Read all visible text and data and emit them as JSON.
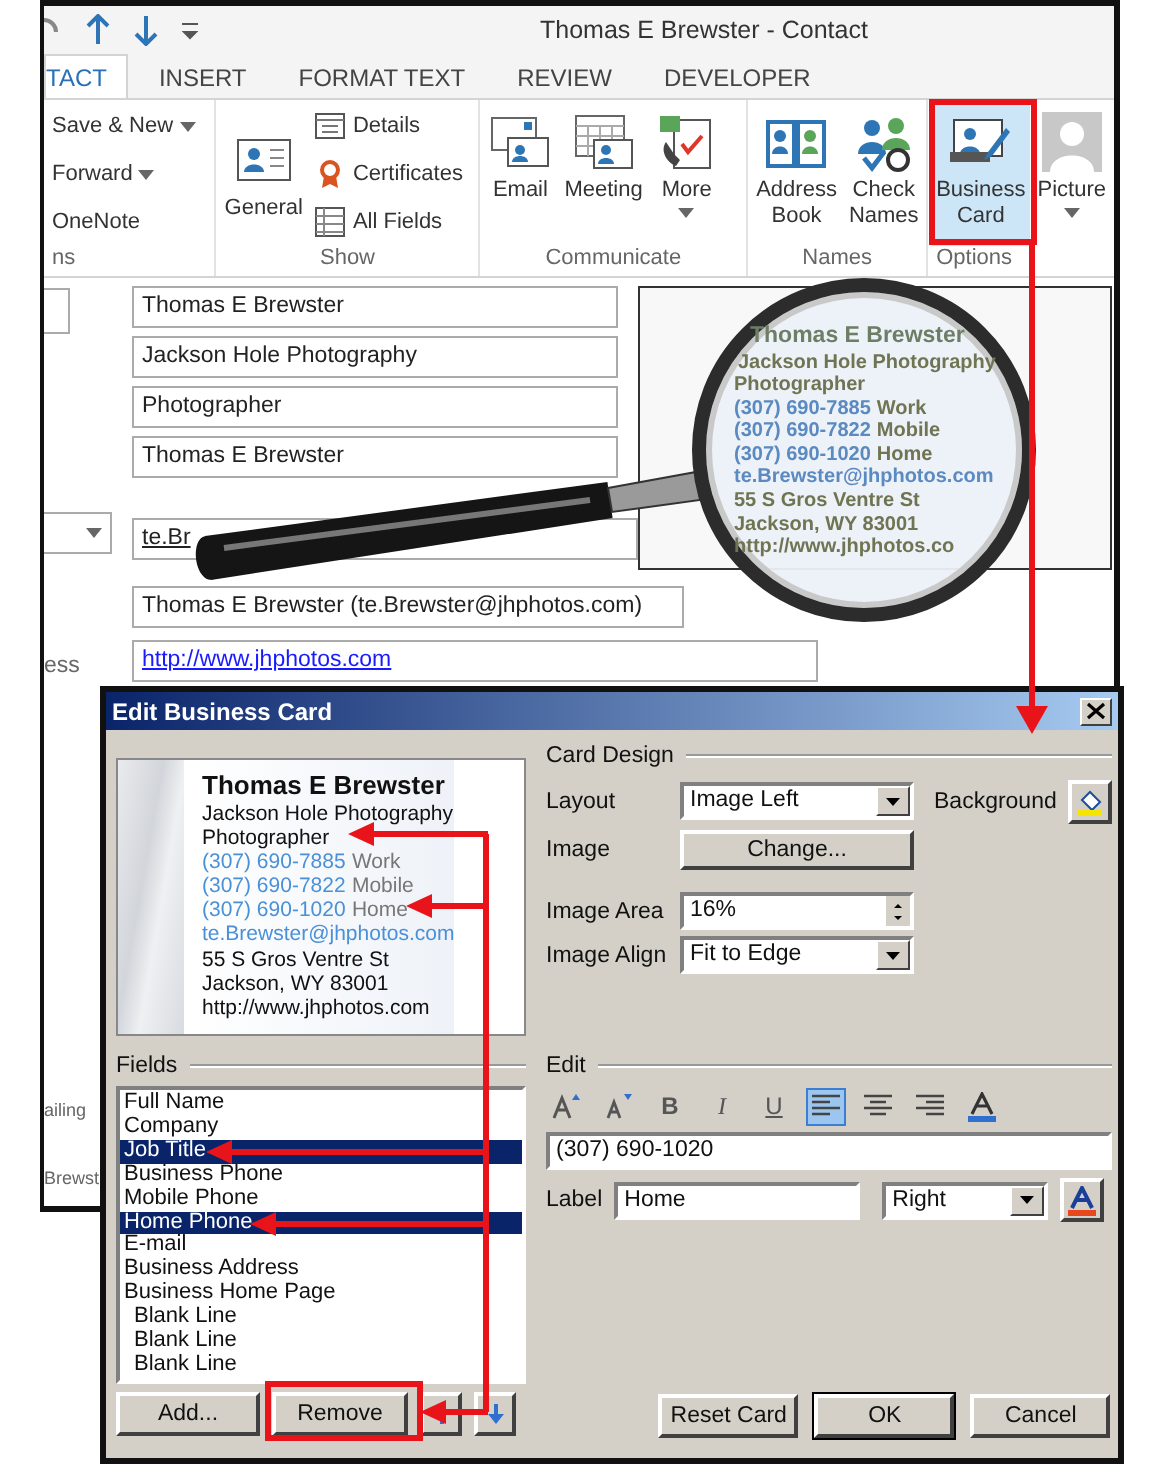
{
  "window": {
    "title": "Thomas E Brewster - Contact"
  },
  "tabs": [
    {
      "label": "TACT",
      "selected": true
    },
    {
      "label": "INSERT",
      "selected": false
    },
    {
      "label": "FORMAT TEXT",
      "selected": false
    },
    {
      "label": "REVIEW",
      "selected": false
    },
    {
      "label": "DEVELOPER",
      "selected": false
    }
  ],
  "ribbon": {
    "groups": [
      {
        "label": "ns",
        "buttons": [
          {
            "label": "Save & New",
            "kind": "small",
            "dropdown": true,
            "highlighted": false
          },
          {
            "label": "Forward",
            "kind": "small",
            "dropdown": true,
            "highlighted": false
          },
          {
            "label": "OneNote",
            "kind": "small",
            "dropdown": false,
            "highlighted": false
          }
        ]
      },
      {
        "label": "Show",
        "buttons": [
          {
            "label": "General",
            "kind": "large",
            "dropdown": false,
            "highlighted": false
          },
          {
            "label": "Details",
            "kind": "small",
            "dropdown": false,
            "highlighted": false
          },
          {
            "label": "Certificates",
            "kind": "small",
            "dropdown": false,
            "highlighted": false
          },
          {
            "label": "All Fields",
            "kind": "small",
            "dropdown": false,
            "highlighted": false
          }
        ]
      },
      {
        "label": "Communicate",
        "buttons": [
          {
            "label": "Email",
            "kind": "large",
            "dropdown": false,
            "highlighted": false
          },
          {
            "label": "Meeting",
            "kind": "large",
            "dropdown": false,
            "highlighted": false
          },
          {
            "label": "More",
            "kind": "large",
            "dropdown": true,
            "highlighted": false
          }
        ]
      },
      {
        "label": "Names",
        "buttons": [
          {
            "label": "Address Book",
            "kind": "large",
            "dropdown": false,
            "highlighted": false
          },
          {
            "label": "Check Names",
            "kind": "large",
            "dropdown": false,
            "highlighted": false
          }
        ]
      },
      {
        "label": "Options",
        "buttons": [
          {
            "label": "Business Card",
            "kind": "large",
            "dropdown": false,
            "highlighted": true
          },
          {
            "label": "Picture",
            "kind": "large",
            "dropdown": true,
            "highlighted": false
          }
        ]
      }
    ]
  },
  "form": {
    "fields": [
      "Thomas E Brewster",
      "Jackson Hole Photography",
      "Photographer",
      "Thomas E Brewster"
    ],
    "email": "te.Br",
    "display_as": "Thomas E Brewster (te.Brewster@jhphotos.com)",
    "web_label": "ess",
    "web_page": "http://www.jhphotos.com",
    "hidden_labels": [
      "ailing",
      "Brewst"
    ]
  },
  "magnifier": {
    "lines": [
      {
        "kind": "name",
        "text": "Thomas E Brewster"
      },
      {
        "kind": "plain",
        "text": "Jackson Hole Photography"
      },
      {
        "kind": "plain",
        "text": "Photographer"
      },
      {
        "kind": "phone",
        "text": "(307) 690-7885",
        "label": "Work"
      },
      {
        "kind": "phone",
        "text": "(307) 690-7822",
        "label": "Mobile"
      },
      {
        "kind": "phone",
        "text": "(307) 690-1020",
        "label": "Home"
      },
      {
        "kind": "email",
        "text": "te.Brewster@jhphotos.com"
      },
      {
        "kind": "plain",
        "text": "55 S Gros Ventre St"
      },
      {
        "kind": "plain",
        "text": "Jackson, WY 83001"
      },
      {
        "kind": "plain",
        "text": "http://www.jhphotos.co"
      }
    ]
  },
  "dialog": {
    "title": "Edit Business Card",
    "card": {
      "lines": [
        {
          "kind": "name",
          "text": "Thomas E Brewster"
        },
        {
          "kind": "plain",
          "text": "Jackson Hole Photography"
        },
        {
          "kind": "plain",
          "text": "Photographer"
        },
        {
          "kind": "phone",
          "text": "(307) 690-7885",
          "label": "Work"
        },
        {
          "kind": "phone",
          "text": "(307) 690-7822",
          "label": "Mobile"
        },
        {
          "kind": "phone",
          "text": "(307) 690-1020",
          "label": "Home"
        },
        {
          "kind": "email",
          "text": "te.Brewster@jhphotos.com"
        },
        {
          "kind": "plain",
          "text": "55 S Gros Ventre St"
        },
        {
          "kind": "plain",
          "text": "Jackson, WY 83001"
        },
        {
          "kind": "plain",
          "text": "http://www.jhphotos.com"
        }
      ]
    },
    "card_design": {
      "heading": "Card Design",
      "layout_label": "Layout",
      "layout": "Image Left",
      "background_label": "Background",
      "image_label": "Image",
      "change_button": "Change...",
      "image_area_label": "Image Area",
      "image_area": "16%",
      "image_align_label": "Image Align",
      "image_align": "Fit to Edge"
    },
    "fields": {
      "heading": "Fields",
      "items": [
        {
          "text": "Full Name",
          "kind": "field",
          "selected": false
        },
        {
          "text": "Company",
          "kind": "field",
          "selected": false
        },
        {
          "text": "Job Title",
          "kind": "field",
          "selected": true
        },
        {
          "text": "Business Phone",
          "kind": "field",
          "selected": false
        },
        {
          "text": "Mobile Phone",
          "kind": "field",
          "selected": false
        },
        {
          "text": "Home Phone",
          "kind": "field",
          "selected": true
        },
        {
          "text": "E-mail",
          "kind": "field",
          "selected": false
        },
        {
          "text": "Business Address",
          "kind": "field",
          "selected": false
        },
        {
          "text": "Business Home Page",
          "kind": "field",
          "selected": false
        },
        {
          "text": "Blank Line",
          "kind": "blank",
          "selected": false
        },
        {
          "text": "Blank Line",
          "kind": "blank",
          "selected": false
        },
        {
          "text": "Blank Line",
          "kind": "blank",
          "selected": false
        }
      ],
      "add_button": "Add...",
      "remove_button": "Remove"
    },
    "edit": {
      "heading": "Edit",
      "toolbar": [
        {
          "kind": "grow",
          "selected": false
        },
        {
          "kind": "shrink",
          "selected": false
        },
        {
          "kind": "bold",
          "text": "B",
          "selected": false
        },
        {
          "kind": "italic",
          "text": "I",
          "selected": false
        },
        {
          "kind": "underline",
          "text": "U",
          "selected": false
        },
        {
          "kind": "left",
          "selected": true
        },
        {
          "kind": "center",
          "selected": false
        },
        {
          "kind": "right",
          "selected": false
        },
        {
          "kind": "color",
          "selected": false
        }
      ],
      "text": "(307) 690-1020",
      "label_label": "Label",
      "label": "Home",
      "position": "Right"
    },
    "buttons": [
      {
        "label": "Reset Card",
        "default": false
      },
      {
        "label": "OK",
        "default": true
      },
      {
        "label": "Cancel",
        "default": false
      }
    ]
  }
}
